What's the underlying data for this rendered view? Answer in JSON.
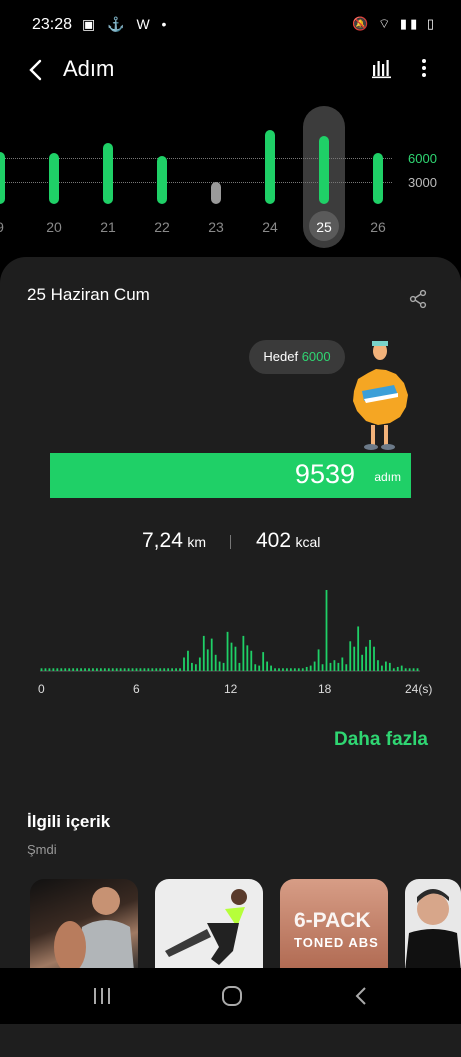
{
  "status": {
    "time": "23:28"
  },
  "header": {
    "title": "Adım"
  },
  "week_chart": {
    "goal_label": "6000",
    "mid_label": "3000",
    "days": [
      {
        "label": "9",
        "value": 6800,
        "selected": false,
        "met": true
      },
      {
        "label": "20",
        "value": 6600,
        "selected": false,
        "met": true
      },
      {
        "label": "21",
        "value": 7900,
        "selected": false,
        "met": true
      },
      {
        "label": "22",
        "value": 6300,
        "selected": false,
        "met": true
      },
      {
        "label": "23",
        "value": 2900,
        "selected": false,
        "met": false
      },
      {
        "label": "24",
        "value": 9700,
        "selected": false,
        "met": true
      },
      {
        "label": "25",
        "value": 8900,
        "selected": true,
        "met": true
      },
      {
        "label": "26",
        "value": 6600,
        "selected": false,
        "met": true
      }
    ]
  },
  "card": {
    "date": "25 Haziran Cum",
    "goal_prefix": "Hedef",
    "goal_value": "6000",
    "steps": "9539",
    "steps_unit": "adım",
    "distance": "7,24",
    "distance_unit": "km",
    "calories": "402",
    "calories_unit": "kcal",
    "hour_labels": [
      "0",
      "6",
      "12",
      "18",
      "24(s)"
    ],
    "more_label": "Daha fazla",
    "related_title": "İlgili içerik",
    "related_sub": "Şmdi",
    "thumbs": [
      {
        "overlay_line1": "",
        "overlay_line2": ""
      },
      {
        "overlay_line1": "",
        "overlay_line2": ""
      },
      {
        "overlay_line1": "6-PACK",
        "overlay_line2": "TONED ABS"
      },
      {
        "overlay_line1": "",
        "overlay_line2": ""
      }
    ]
  },
  "hourly": [
    0.1,
    0.1,
    0.1,
    0.1,
    0.1,
    0.1,
    0.1,
    0.1,
    0.1,
    0.1,
    0.1,
    0.1,
    0.1,
    0.1,
    0.1,
    0.1,
    0.1,
    0.1,
    0.1,
    0.1,
    0.1,
    0.1,
    0.1,
    0.1,
    0.1,
    0.1,
    0.1,
    0.1,
    0.1,
    0.1,
    0.1,
    0.1,
    0.1,
    0.1,
    0.1,
    0.1,
    0.5,
    0.75,
    0.3,
    0.25,
    0.5,
    1.3,
    0.8,
    1.2,
    0.6,
    0.35,
    0.3,
    1.45,
    1.05,
    0.9,
    0.3,
    1.3,
    0.95,
    0.75,
    0.25,
    0.2,
    0.7,
    0.35,
    0.2,
    0.1,
    0.1,
    0.1,
    0.1,
    0.1,
    0.1,
    0.1,
    0.1,
    0.15,
    0.2,
    0.35,
    0.8,
    0.25,
    3.0,
    0.3,
    0.4,
    0.3,
    0.5,
    0.25,
    1.1,
    0.9,
    1.65,
    0.6,
    0.9,
    1.15,
    0.9,
    0.4,
    0.2,
    0.35,
    0.3,
    0.1,
    0.15,
    0.2,
    0.1,
    0.1,
    0.1,
    0.1
  ]
}
